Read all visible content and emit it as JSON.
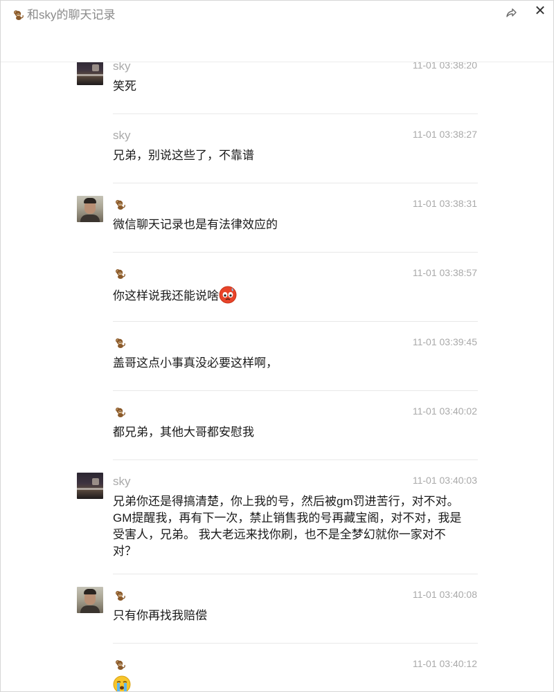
{
  "window": {
    "title": "和sky的聊天记录",
    "title_icon": "monkey-icon",
    "share_icon": "share-icon",
    "close_icon": "close-icon",
    "close_glyph": "✕"
  },
  "messages": [
    {
      "sender": "sky",
      "avatar": "avatar-sky",
      "time": "11-01 03:38:20",
      "text": "笑死"
    },
    {
      "sender": "sky",
      "avatar": "",
      "time": "11-01 03:38:27",
      "text": "兄弟，别说这些了，不靠谱"
    },
    {
      "sender": "",
      "sender_icon": "monkey-icon",
      "avatar": "avatar-me",
      "time": "11-01 03:38:31",
      "text": "微信聊天记录也是有法律效应的"
    },
    {
      "sender": "",
      "sender_icon": "monkey-icon",
      "avatar": "",
      "time": "11-01 03:38:57",
      "text": "你这样说我还能说啥",
      "trailing_emoji": "sweat-angry-face-emoji"
    },
    {
      "sender": "",
      "sender_icon": "monkey-icon",
      "avatar": "",
      "time": "11-01 03:39:45",
      "text": "盖哥这点小事真没必要这样啊，"
    },
    {
      "sender": "",
      "sender_icon": "monkey-icon",
      "avatar": "",
      "time": "11-01 03:40:02",
      "text": "都兄弟，其他大哥都安慰我"
    },
    {
      "sender": "sky",
      "avatar": "avatar-sky",
      "time": "11-01 03:40:03",
      "text": "兄弟你还是得搞清楚，你上我的号，然后被gm罚进苦行，对不对。 GM提醒我，再有下一次，禁止销售我的号再藏宝阁，对不对，我是受害人，兄弟。 我大老远来找你刷，也不是全梦幻就你一家对不对？"
    },
    {
      "sender": "",
      "sender_icon": "monkey-icon",
      "avatar": "avatar-me",
      "time": "11-01 03:40:08",
      "text": "只有你再找我赔偿"
    },
    {
      "sender": "",
      "sender_icon": "monkey-icon",
      "avatar": "",
      "time": "11-01 03:40:12",
      "text": "",
      "trailing_emoji": "crying-face-emoji"
    }
  ]
}
